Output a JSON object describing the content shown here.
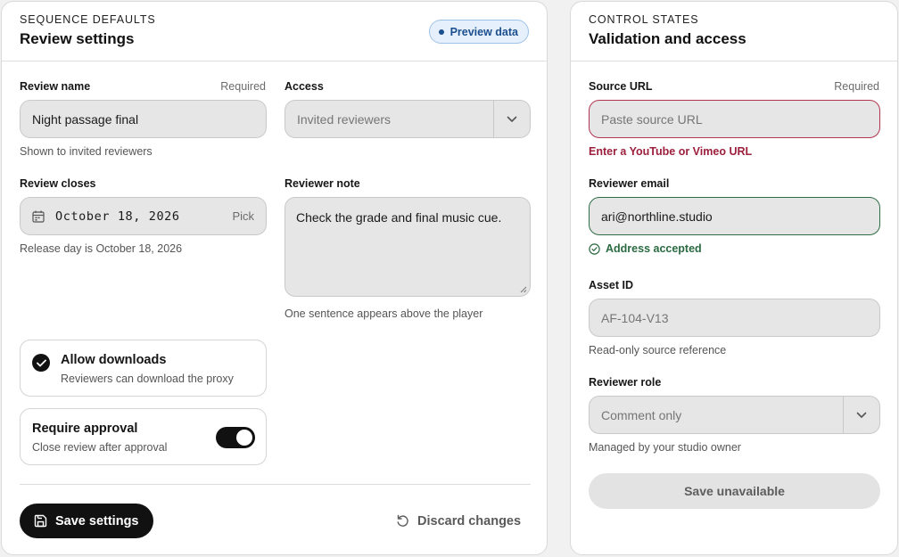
{
  "left_panel": {
    "eyebrow": "SEQUENCE DEFAULTS",
    "title": "Review settings",
    "badge": "Preview data",
    "review_name": {
      "label": "Review name",
      "required": "Required",
      "value": "Night passage final",
      "help": "Shown to invited reviewers"
    },
    "access": {
      "label": "Access",
      "value": "Invited reviewers"
    },
    "review_closes": {
      "label": "Review closes",
      "value": "October 18, 2026",
      "pick": "Pick",
      "help": "Release day is October 18, 2026"
    },
    "reviewer_note": {
      "label": "Reviewer note",
      "value": "Check the grade and final music cue.",
      "help": "One sentence appears above the player"
    },
    "allow_downloads": {
      "title": "Allow downloads",
      "subtitle": "Reviewers can download the proxy",
      "checked": true
    },
    "require_approval": {
      "title": "Require approval",
      "subtitle": "Close review after approval",
      "on": true
    },
    "save_label": "Save settings",
    "discard_label": "Discard changes"
  },
  "right_panel": {
    "eyebrow": "CONTROL STATES",
    "title": "Validation and access",
    "source_url": {
      "label": "Source URL",
      "required": "Required",
      "placeholder": "Paste source URL",
      "error": "Enter a YouTube or Vimeo URL"
    },
    "reviewer_email": {
      "label": "Reviewer email",
      "value": "ari@northline.studio",
      "success": "Address accepted"
    },
    "asset_id": {
      "label": "Asset ID",
      "value": "AF-104-V13",
      "help": "Read-only source reference"
    },
    "reviewer_role": {
      "label": "Reviewer role",
      "value": "Comment only",
      "help": "Managed by your studio owner"
    },
    "save_unavailable_label": "Save unavailable"
  },
  "colors": {
    "accent_badge": "#1c4f8e",
    "error": "#9c1f3c",
    "success": "#2a6a41",
    "primary_button": "#111111"
  },
  "icons": [
    "calendar-icon",
    "chevron-down-icon",
    "check-icon",
    "save-icon",
    "undo-icon",
    "check-circle-icon"
  ]
}
